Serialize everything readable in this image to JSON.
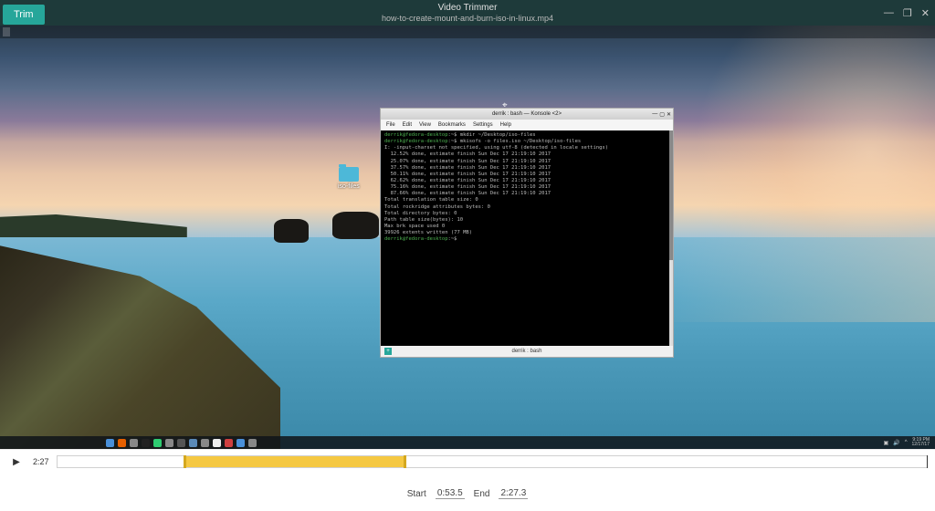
{
  "app": {
    "title": "Video Trimmer",
    "filename": "how-to-create-mount-and-burn-iso-in-linux.mp4",
    "trim_label": "Trim"
  },
  "window_controls": {
    "minimize": "—",
    "maximize": "❐",
    "close": "✕"
  },
  "desktop": {
    "folder_label": "iso-files",
    "taskbar_time": "9:19 PM",
    "taskbar_date": "12/17/17",
    "taskbar_icons": [
      {
        "name": "app-menu-icon",
        "color": "#4a90d9"
      },
      {
        "name": "firefox-icon",
        "color": "#e66000"
      },
      {
        "name": "files-icon",
        "color": "#888"
      },
      {
        "name": "terminal-icon",
        "color": "#222"
      },
      {
        "name": "chat-icon",
        "color": "#2ecc71"
      },
      {
        "name": "music-icon",
        "color": "#888"
      },
      {
        "name": "steam-icon",
        "color": "#555"
      },
      {
        "name": "settings-icon",
        "color": "#5a8ab8"
      },
      {
        "name": "editor-icon",
        "color": "#888"
      },
      {
        "name": "konsole-icon",
        "color": "#eee"
      },
      {
        "name": "record-icon",
        "color": "#d04040"
      },
      {
        "name": "util-icon",
        "color": "#4a90d9"
      },
      {
        "name": "tool-icon",
        "color": "#888"
      }
    ]
  },
  "terminal": {
    "title": "derrik : bash — Konsole <2>",
    "menu": [
      "File",
      "Edit",
      "View",
      "Bookmarks",
      "Settings",
      "Help"
    ],
    "footer": "derrik : bash",
    "lines": [
      {
        "prompt": "derrik@fedora-desktop",
        "text": ":~$ mkdir ~/Desktop/iso-files"
      },
      {
        "prompt": "derrik@fedora-desktop",
        "text": ":~$ mkisofs -o files.iso ~/Desktop/iso-files"
      },
      {
        "text": "I: -input-charset not specified, using utf-8 (detected in locale settings)"
      },
      {
        "text": "  12.52% done, estimate finish Sun Dec 17 21:19:10 2017"
      },
      {
        "text": "  25.07% done, estimate finish Sun Dec 17 21:19:10 2017"
      },
      {
        "text": "  37.57% done, estimate finish Sun Dec 17 21:19:10 2017"
      },
      {
        "text": "  50.11% done, estimate finish Sun Dec 17 21:19:10 2017"
      },
      {
        "text": "  62.62% done, estimate finish Sun Dec 17 21:19:10 2017"
      },
      {
        "text": "  75.16% done, estimate finish Sun Dec 17 21:19:10 2017"
      },
      {
        "text": "  87.66% done, estimate finish Sun Dec 17 21:19:10 2017"
      },
      {
        "text": "Total translation table size: 0"
      },
      {
        "text": "Total rockridge attributes bytes: 0"
      },
      {
        "text": "Total directory bytes: 0"
      },
      {
        "text": "Path table size(bytes): 10"
      },
      {
        "text": "Max brk space used 0"
      },
      {
        "text": "39926 extents written (77 MB)"
      },
      {
        "prompt": "derrik@fedora-desktop",
        "text": ":~$ "
      }
    ]
  },
  "playback": {
    "current_time": "2:27",
    "duration_seconds": 147.3
  },
  "range": {
    "start_label": "Start",
    "start_value": "0:53.5",
    "end_label": "End",
    "end_value": "2:27.3"
  },
  "timeline": {
    "selection_left_pct": 14.5,
    "selection_width_pct": 25.3,
    "playhead_pct": 100
  }
}
